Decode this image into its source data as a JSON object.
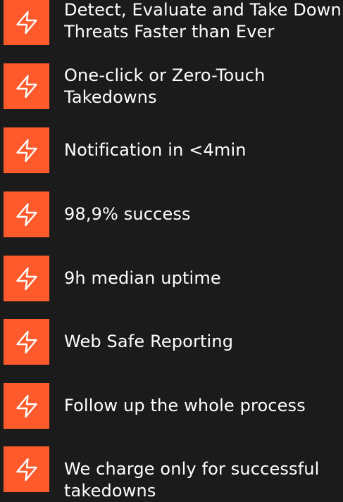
{
  "theme": {
    "background": "#1b1b1b",
    "accent": "#ff5a2c",
    "text": "#ffffff"
  },
  "features": [
    {
      "icon": "lightning-icon",
      "text": "Detect, Evaluate and Take Down Threats Faster than Ever"
    },
    {
      "icon": "lightning-icon",
      "text": "One-click or Zero-Touch Takedowns"
    },
    {
      "icon": "lightning-icon",
      "text": "Notification in <4min"
    },
    {
      "icon": "lightning-icon",
      "text": "98,9% success"
    },
    {
      "icon": "lightning-icon",
      "text": "9h median uptime"
    },
    {
      "icon": "lightning-icon",
      "text": "Web Safe Reporting"
    },
    {
      "icon": "lightning-icon",
      "text": "Follow up the whole process"
    },
    {
      "icon": "lightning-icon",
      "text": "We charge only for successful takedowns"
    }
  ]
}
